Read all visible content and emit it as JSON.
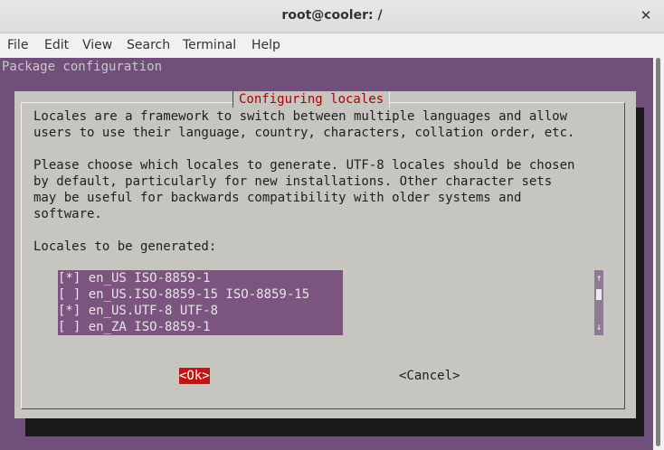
{
  "window": {
    "title": "root@cooler: /",
    "close_glyph": "✕"
  },
  "menu": [
    "File",
    "Edit",
    "View",
    "Search",
    "Terminal",
    "Help"
  ],
  "terminal": {
    "header": "Package configuration",
    "dialog": {
      "title": "Configuring locales",
      "intro": [
        "Locales are a framework to switch between multiple languages and allow",
        "users to use their language, country, characters, collation order, etc."
      ],
      "description": [
        "Please choose which locales to generate. UTF-8 locales should be chosen",
        "by default, particularly for new installations. Other character sets",
        "may be useful for backwards compatibility with older systems and",
        "software."
      ],
      "list_label": "Locales to be generated:",
      "locales": [
        {
          "text": "[*] en_US ISO-8859-1"
        },
        {
          "text": "[ ] en_US.ISO-8859-15 ISO-8859-15"
        },
        {
          "text": "[*] en_US.UTF-8 UTF-8"
        },
        {
          "text": "[ ] en_ZA ISO-8859-1"
        }
      ],
      "scroll_up": "↑",
      "scroll_down": "↓",
      "ok_label": "<Ok>",
      "cancel_label": "<Cancel>"
    }
  }
}
